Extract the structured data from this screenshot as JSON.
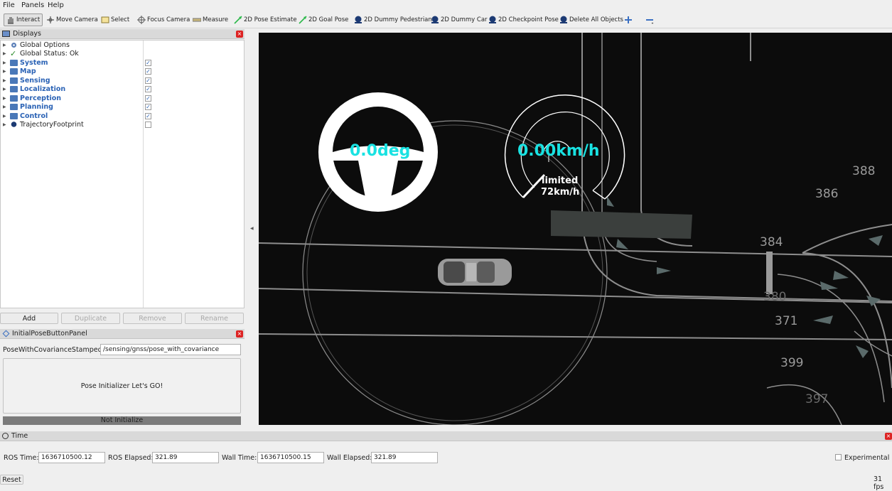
{
  "menubar": {
    "items": [
      "File",
      "Panels",
      "Help"
    ]
  },
  "toolbar": {
    "tools": [
      {
        "label": "Interact",
        "icon": "hand-icon"
      },
      {
        "label": "Move Camera",
        "icon": "move-camera-icon"
      },
      {
        "label": "Select",
        "icon": "select-icon"
      },
      {
        "label": "Focus Camera",
        "icon": "focus-camera-icon"
      },
      {
        "label": "Measure",
        "icon": "measure-icon"
      },
      {
        "label": "2D Pose Estimate",
        "icon": "pose-arrow-icon"
      },
      {
        "label": "2D Goal Pose",
        "icon": "goal-arrow-icon"
      },
      {
        "label": "2D Dummy Pedestrian",
        "icon": "autoware-icon"
      },
      {
        "label": "2D Dummy Car",
        "icon": "autoware-icon"
      },
      {
        "label": "2D Checkpoint Pose",
        "icon": "autoware-icon"
      },
      {
        "label": "Delete All Objects",
        "icon": "autoware-icon"
      }
    ]
  },
  "displays": {
    "title": "Displays",
    "items": [
      {
        "label": "Global Options",
        "checked": null
      },
      {
        "label": "Global Status: Ok",
        "checked": null
      },
      {
        "label": "System",
        "checked": true
      },
      {
        "label": "Map",
        "checked": true
      },
      {
        "label": "Sensing",
        "checked": true
      },
      {
        "label": "Localization",
        "checked": true
      },
      {
        "label": "Perception",
        "checked": true
      },
      {
        "label": "Planning",
        "checked": true
      },
      {
        "label": "Control",
        "checked": true
      },
      {
        "label": "TrajectoryFootprint",
        "checked": false
      }
    ],
    "buttons": {
      "add": "Add",
      "duplicate": "Duplicate",
      "remove": "Remove",
      "rename": "Rename"
    }
  },
  "initial_pose_panel": {
    "title": "InitialPoseButtonPanel",
    "topic_label": "PoseWithCovarianceStamped",
    "topic_value": "/sensing/gnss/pose_with_covariance",
    "go_button": "Pose Initializer Let's GO!",
    "status": "Not Initialize"
  },
  "viewport": {
    "steering_text": "0.0deg",
    "speed_text": "0.00km/h",
    "limit_line1": "limited",
    "limit_line2": "72km/h",
    "lane_ids": [
      "388",
      "386",
      "384",
      "380",
      "371",
      "399",
      "397"
    ],
    "accent": "#19e2e2"
  },
  "time_panel": {
    "title": "Time",
    "ros_time_label": "ROS Time:",
    "ros_time": "1636710500.12",
    "ros_elapsed_label": "ROS Elapsed:",
    "ros_elapsed": "321.89",
    "wall_time_label": "Wall Time:",
    "wall_time": "1636710500.15",
    "wall_elapsed_label": "Wall Elapsed:",
    "wall_elapsed": "321.89",
    "experimental": "Experimental",
    "reset": "Reset",
    "fps": "31 fps"
  }
}
